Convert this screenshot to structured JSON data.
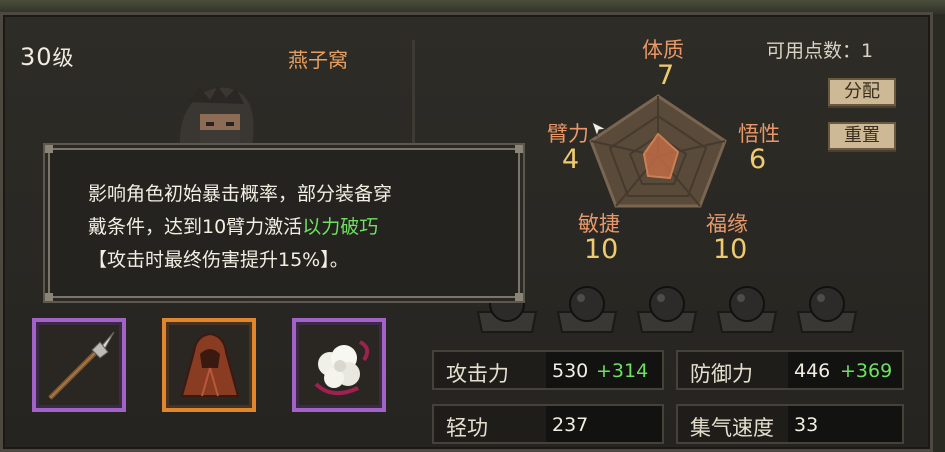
{
  "character": {
    "level_number": "30",
    "level_unit": "级",
    "name": "燕子窝"
  },
  "tooltip": {
    "line1": "影响角色初始暴击概率，部分装备穿",
    "line2_prefix": "戴条件，达到10臂力激活",
    "line2_highlight": "以力破巧",
    "line3": "【攻击时最终伤害提升15%】。"
  },
  "equipment": [
    {
      "name": "spear",
      "rarity": "purple"
    },
    {
      "name": "cloak",
      "rarity": "orange"
    },
    {
      "name": "fur-accessory",
      "rarity": "purple"
    }
  ],
  "points": {
    "label": "可用点数：",
    "value": "1"
  },
  "buttons": {
    "allocate": "分配",
    "reset": "重置"
  },
  "attributes": {
    "constitution": {
      "name": "体质",
      "value": 7
    },
    "comprehension": {
      "name": "悟性",
      "value": 6
    },
    "fortune": {
      "name": "福缘",
      "value": 10
    },
    "agility": {
      "name": "敏捷",
      "value": 10
    },
    "strength": {
      "name": "臂力",
      "value": 4
    }
  },
  "stats": {
    "attack": {
      "label": "攻击力",
      "value": "530",
      "bonus": "+314"
    },
    "defense": {
      "label": "防御力",
      "value": "446",
      "bonus": "+369"
    },
    "qinggong": {
      "label": "轻功",
      "value": "237"
    },
    "qi_speed": {
      "label": "集气速度",
      "value": "33"
    }
  },
  "colors": {
    "purple": "#a262c8",
    "orange": "#e0872e",
    "highlight": "#6ee062",
    "attr_name": "#e89868",
    "attr_value": "#f0ca70"
  }
}
